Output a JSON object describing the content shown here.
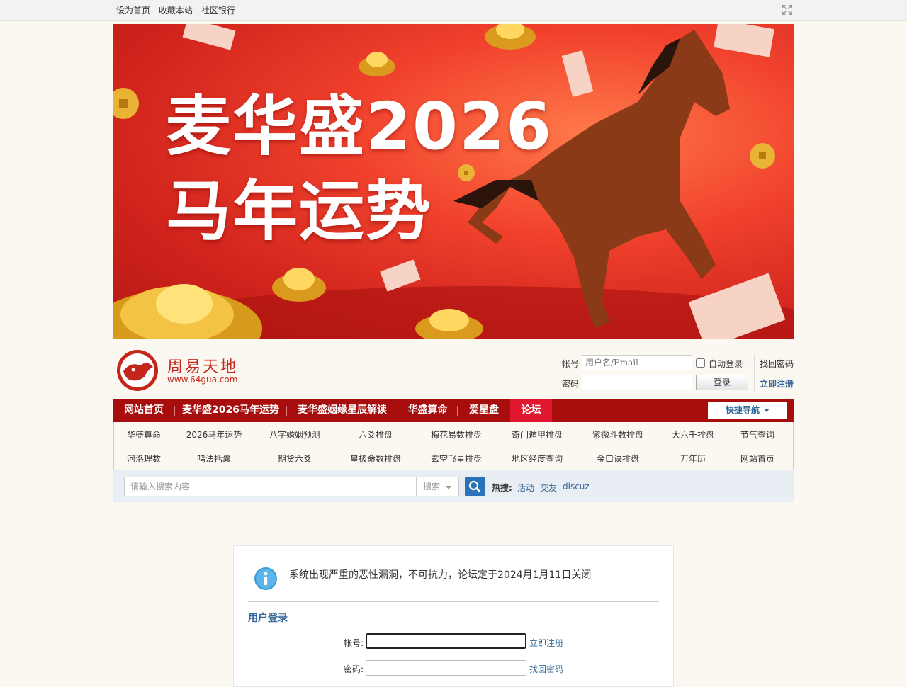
{
  "topbar": {
    "links": [
      "设为首页",
      "收藏本站",
      "社区银行"
    ],
    "fullscreen_icon": "fullscreen-icon"
  },
  "banner": {
    "line1": "麦华盛2026",
    "line2": "马年运势"
  },
  "logo": {
    "name": "周易天地",
    "url": "www.64gua.com"
  },
  "header_login": {
    "account_label": "帐号",
    "account_placeholder": "用户名/Email",
    "password_label": "密码",
    "auto_login": "自动登录",
    "login_button": "登录",
    "find_password": "找回密码",
    "register": "立即注册"
  },
  "nav": {
    "items": [
      "网站首页",
      "麦华盛2026马年运势",
      "麦华盛姻缘星辰解读",
      "华盛算命",
      "爱星盘",
      "论坛"
    ],
    "active": "论坛",
    "quick_nav": "快捷导航"
  },
  "subnav": {
    "row1": [
      "华盛算命",
      "2026马年运势",
      "八字婚姻预测",
      "六爻排盘",
      "梅花易数排盘",
      "奇门遁甲排盘",
      "紫微斗数排盘",
      "大六壬排盘",
      "节气查询"
    ],
    "row2": [
      "河洛理数",
      "鸣法括囊",
      "期货六爻",
      "皇极命数排盘",
      "玄空飞星排盘",
      "地区经度查询",
      "金口诀排盘",
      "万年历",
      "网站首页"
    ]
  },
  "search": {
    "placeholder": "请输入搜索内容",
    "type": "搜索",
    "hot_label": "热搜:",
    "hot_keywords": [
      "活动",
      "交友",
      "discuz"
    ]
  },
  "message": {
    "text": "系统出现严重的恶性漏洞，不可抗力，论坛定于2024月1月11日关闭",
    "login_title": "用户登录",
    "account_label": "帐号:",
    "register_link": "立即注册",
    "password_label": "密码:",
    "find_password_link": "找回密码"
  },
  "colors": {
    "nav_bg": "#a80d0d",
    "nav_active": "#e0172f",
    "link_blue": "#336699",
    "brand_red": "#c5261b"
  }
}
